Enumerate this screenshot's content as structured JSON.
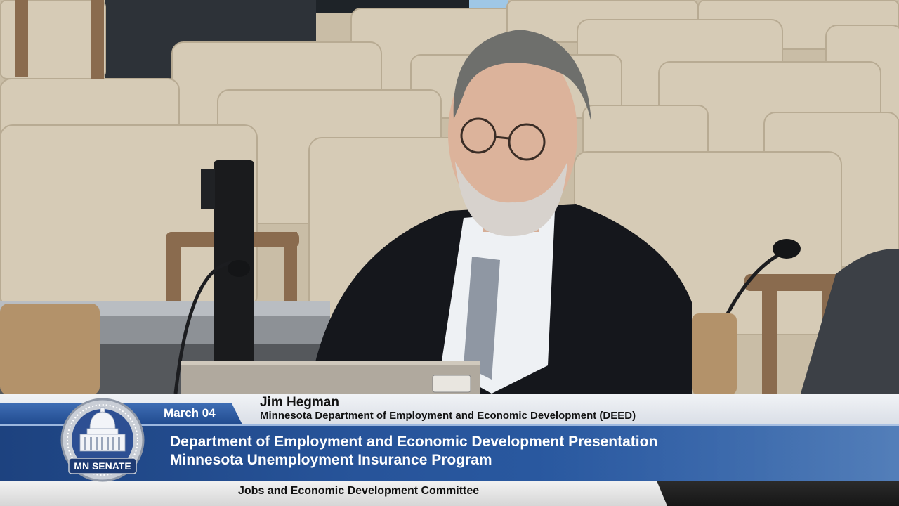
{
  "lower_third": {
    "date": "March 04",
    "speaker_name": "Jim Hegman",
    "speaker_org": "Minnesota Department of Employment and Economic Development (DEED)",
    "title_line1": "Department of Employment and Economic Development Presentation",
    "title_line2": "Minnesota Unemployment Insurance Program",
    "committee": "Jobs and Economic Development Committee"
  },
  "seal": {
    "label": "MN SENATE",
    "icon": "capitol-dome-icon"
  },
  "colors": {
    "banner_blue": "#24509a",
    "strip_light": "#e4e8ee",
    "text_dark": "#111111",
    "seats": "#d3c7b1",
    "suit": "#15171c"
  }
}
